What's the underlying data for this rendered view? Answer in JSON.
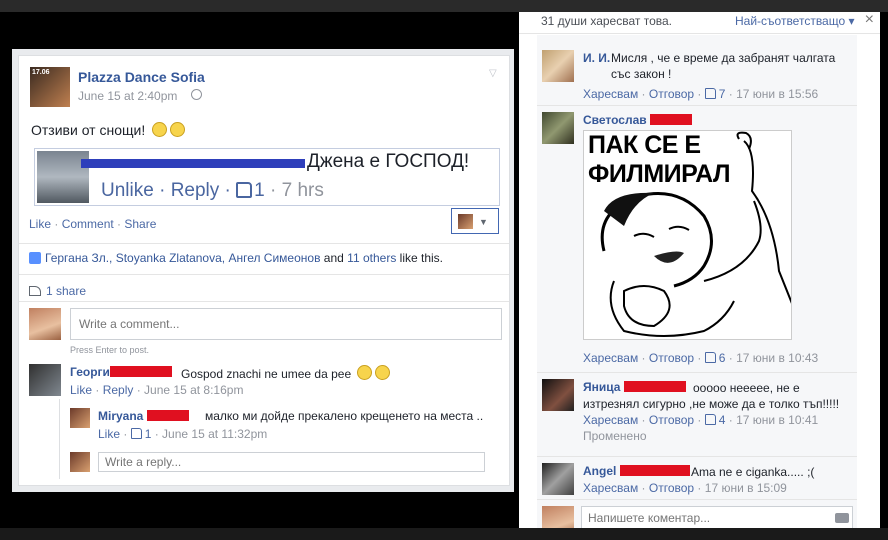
{
  "post": {
    "page_name": "Plazza Dance Sofia",
    "avatar_text": "17.06",
    "time": "June 15 at 2:40pm",
    "status": "Отзиви от снощи!",
    "screenshot": {
      "comment_text": "Джена е ГОСПОД!",
      "unlike": "Unlike",
      "reply": "Reply",
      "likes": "1",
      "time": "7 hrs"
    },
    "actions": {
      "like": "Like",
      "comment": "Comment",
      "share": "Share"
    },
    "likes_line": {
      "names": "Гергана Зл., Stoyanka Zlatanova, Ангел Симеонов",
      "and": "and",
      "others": "11 others",
      "suffix": "like this."
    },
    "shares": "1 share",
    "comment_placeholder": "Write a comment...",
    "hint": "Press Enter to post.",
    "comments": [
      {
        "name": "Георги",
        "text": "Gospod znachi ne umee da pee",
        "like": "Like",
        "reply": "Reply",
        "time": "June 15 at 8:16pm"
      },
      {
        "name": "Miryana",
        "text": "малко ми дойде прекалено крещенето на места ..",
        "like": "Like",
        "likes": "1",
        "time": "June 15 at 11:32pm"
      }
    ],
    "reply_placeholder": "Write a reply..."
  },
  "panel": {
    "top_left": "31 души харесват това.",
    "top_right": "Най-съответстващо",
    "close": "×",
    "comments": [
      {
        "name": "И. И.",
        "text": "Мисля , че е време да забранят чалгата със закон !",
        "like": "Харесвам",
        "reply": "Отговор",
        "likes": "7",
        "time": "17 юни в 15:56"
      },
      {
        "name": "Светослав",
        "meme_line1": "ПАК СЕ Е",
        "meme_line2": "ФИЛМИРАЛ",
        "like": "Харесвам",
        "reply": "Отговор",
        "likes": "6",
        "time": "17 юни в 10:43"
      },
      {
        "name": "Яница",
        "text": "ооооо неееее, не е изтрезнял сигурно ,не може да е толко тъп!!!!!",
        "like": "Харесвам",
        "reply": "Отговор",
        "likes": "4",
        "time": "17 юни в 10:41",
        "edited": "Променено"
      },
      {
        "name": "Angel",
        "text": "Ama ne e ciganka..... ;(",
        "like": "Харесвам",
        "reply": "Отговор",
        "time": "17 юни в 15:09"
      }
    ],
    "input_placeholder": "Напишете коментар..."
  }
}
